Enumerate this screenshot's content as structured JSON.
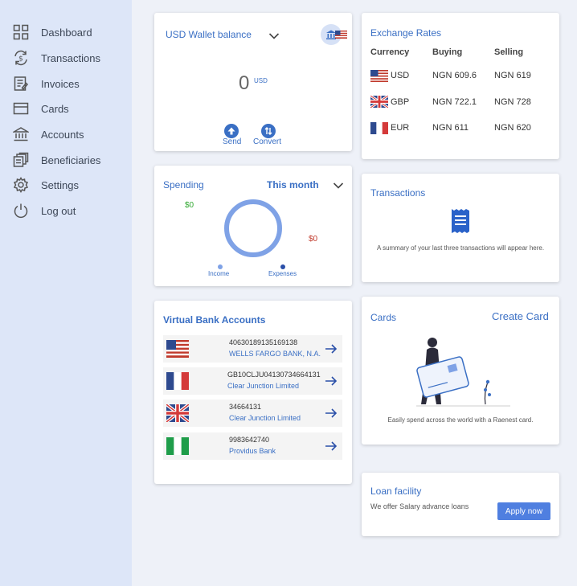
{
  "sidebar": {
    "items": [
      {
        "label": "Dashboard",
        "icon": "grid-icon"
      },
      {
        "label": "Transactions",
        "icon": "exchange-dollar-icon"
      },
      {
        "label": "Invoices",
        "icon": "invoice-icon"
      },
      {
        "label": "Cards",
        "icon": "card-icon"
      },
      {
        "label": "Accounts",
        "icon": "bank-icon"
      },
      {
        "label": "Beneficiaries",
        "icon": "beneficiaries-icon"
      },
      {
        "label": "Settings",
        "icon": "gear-icon"
      },
      {
        "label": "Log out",
        "icon": "power-icon"
      }
    ]
  },
  "wallet": {
    "title": "USD Wallet balance",
    "balance": "0",
    "currency": "USD",
    "send_label": "Send",
    "convert_label": "Convert"
  },
  "spending": {
    "title": "Spending",
    "period": "This month",
    "income_value": "$0",
    "expenses_value": "$0",
    "income_label": "Income",
    "expenses_label": "Expenses",
    "income_color": "#2fa82f",
    "expenses_color": "#c0392b"
  },
  "virtual_accounts": {
    "title": "Virtual Bank Accounts",
    "rows": [
      {
        "flag": "us",
        "number": "40630189135169138",
        "bank": "WELLS FARGO BANK, N.A."
      },
      {
        "flag": "fr",
        "number": "GB10CLJU04130734664131",
        "bank": "Clear Junction Limited"
      },
      {
        "flag": "gb",
        "number": "34664131",
        "bank": "Clear Junction Limited"
      },
      {
        "flag": "ng",
        "number": "9983642740",
        "bank": "Providus Bank"
      }
    ]
  },
  "exchange": {
    "title": "Exchange Rates",
    "headers": [
      "Currency",
      "Buying",
      "Selling"
    ],
    "rows": [
      {
        "flag": "us",
        "currency": "USD",
        "buying": "NGN 609.6",
        "selling": "NGN 619"
      },
      {
        "flag": "gb",
        "currency": "GBP",
        "buying": "NGN 722.1",
        "selling": "NGN 728"
      },
      {
        "flag": "fr",
        "currency": "EUR",
        "buying": "NGN 611",
        "selling": "NGN 620"
      }
    ]
  },
  "transactions": {
    "title": "Transactions",
    "empty_text": "A summary of your last three transactions will appear here."
  },
  "cards": {
    "title": "Cards",
    "create_label": "Create Card",
    "caption": "Easily spend across the world with a Raenest card."
  },
  "loan": {
    "title": "Loan facility",
    "text": "We offer Salary advance loans",
    "apply_label": "Apply now"
  },
  "colors": {
    "accent": "#3a6fc4",
    "sidebar_bg": "#dde6f8",
    "page_bg": "#eef1f8"
  }
}
